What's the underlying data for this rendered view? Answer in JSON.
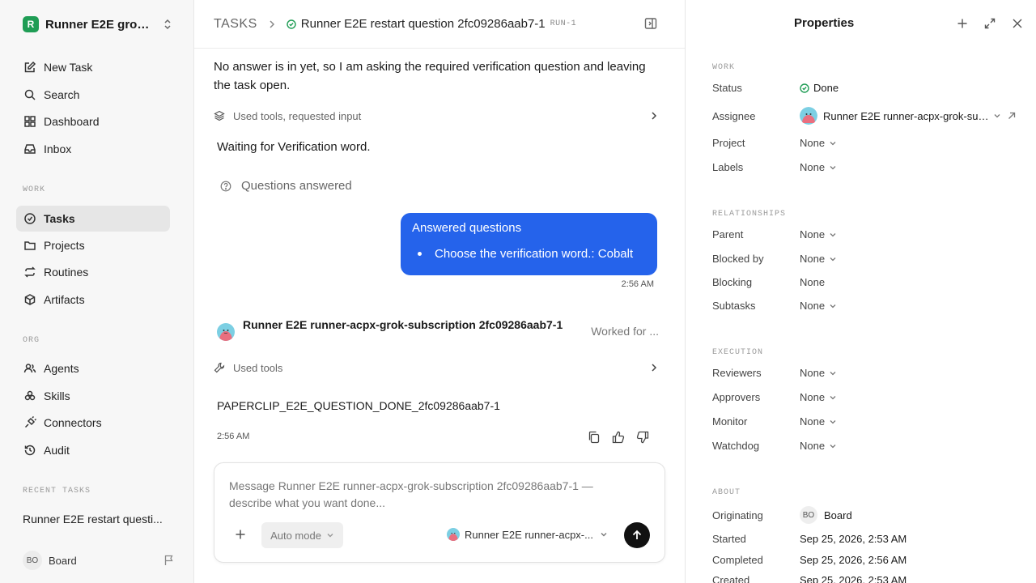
{
  "sidebar": {
    "workspace_logo": "R",
    "workspace_name": "Runner E2E grok-...",
    "nav_top": [
      {
        "label": "New Task",
        "icon": "edit-icon"
      },
      {
        "label": "Search",
        "icon": "search-icon"
      },
      {
        "label": "Dashboard",
        "icon": "dashboard-icon"
      },
      {
        "label": "Inbox",
        "icon": "inbox-icon"
      }
    ],
    "work_label": "WORK",
    "work_items": [
      {
        "label": "Tasks",
        "icon": "check-circle-icon",
        "active": true
      },
      {
        "label": "Projects",
        "icon": "folder-icon"
      },
      {
        "label": "Routines",
        "icon": "repeat-icon"
      },
      {
        "label": "Artifacts",
        "icon": "box-icon"
      }
    ],
    "org_label": "ORG",
    "org_items": [
      {
        "label": "Agents",
        "icon": "users-icon"
      },
      {
        "label": "Skills",
        "icon": "skills-icon"
      },
      {
        "label": "Connectors",
        "icon": "plug-icon"
      },
      {
        "label": "Audit",
        "icon": "history-icon"
      }
    ],
    "recent_label": "RECENT TASKS",
    "recent_items": [
      "Runner E2E restart questi..."
    ],
    "user_initials": "BO",
    "user_name": "Board"
  },
  "header": {
    "crumb": "TASKS",
    "title": "Runner E2E restart question 2fc09286aab7-1",
    "run": "RUN-1"
  },
  "thread": {
    "intro": "No answer is in yet, so I am asking the required verification question and leaving the task open.",
    "tools_requested": "Used tools, requested input",
    "waiting": "Waiting for Verification word.",
    "questions_answered": "Questions answered",
    "bubble_title": "Answered questions",
    "bubble_item": "Choose the verification word.: Cobalt",
    "bubble_time": "2:56 AM",
    "agent_name": "Runner E2E runner-acpx-grok-subscription 2fc09286aab7-1",
    "worked_for": "Worked for ...",
    "tools_used": "Used tools",
    "done_text": "PAPERCLIP_E2E_QUESTION_DONE_2fc09286aab7-1",
    "done_time": "2:56 AM"
  },
  "composer": {
    "placeholder": "Message Runner E2E runner-acpx-grok-subscription 2fc09286aab7-1 — describe what you want done...",
    "mode": "Auto mode",
    "agent": "Runner E2E runner-acpx-..."
  },
  "properties": {
    "title": "Properties",
    "work_label": "WORK",
    "status_label": "Status",
    "status_value": "Done",
    "assignee_label": "Assignee",
    "assignee_value": "Runner E2E runner-acpx-grok-sub...",
    "project_label": "Project",
    "project_value": "None",
    "labels_label": "Labels",
    "labels_value": "None",
    "relationships_label": "RELATIONSHIPS",
    "parent_label": "Parent",
    "parent_value": "None",
    "blocked_by_label": "Blocked by",
    "blocked_by_value": "None",
    "blocking_label": "Blocking",
    "blocking_value": "None",
    "subtasks_label": "Subtasks",
    "subtasks_value": "None",
    "execution_label": "EXECUTION",
    "reviewers_label": "Reviewers",
    "reviewers_value": "None",
    "approvers_label": "Approvers",
    "approvers_value": "None",
    "monitor_label": "Monitor",
    "monitor_value": "None",
    "watchdog_label": "Watchdog",
    "watchdog_value": "None",
    "about_label": "ABOUT",
    "originating_label": "Originating",
    "originating_initials": "BO",
    "originating_value": "Board",
    "started_label": "Started",
    "started_value": "Sep 25, 2026, 2:53 AM",
    "completed_label": "Completed",
    "completed_value": "Sep 25, 2026, 2:56 AM",
    "created_label": "Created",
    "created_value": "Sep 25, 2026, 2:53 AM"
  },
  "colors": {
    "accent": "#2563eb",
    "status_done": "#1f9d55",
    "send_button": "#111111"
  }
}
